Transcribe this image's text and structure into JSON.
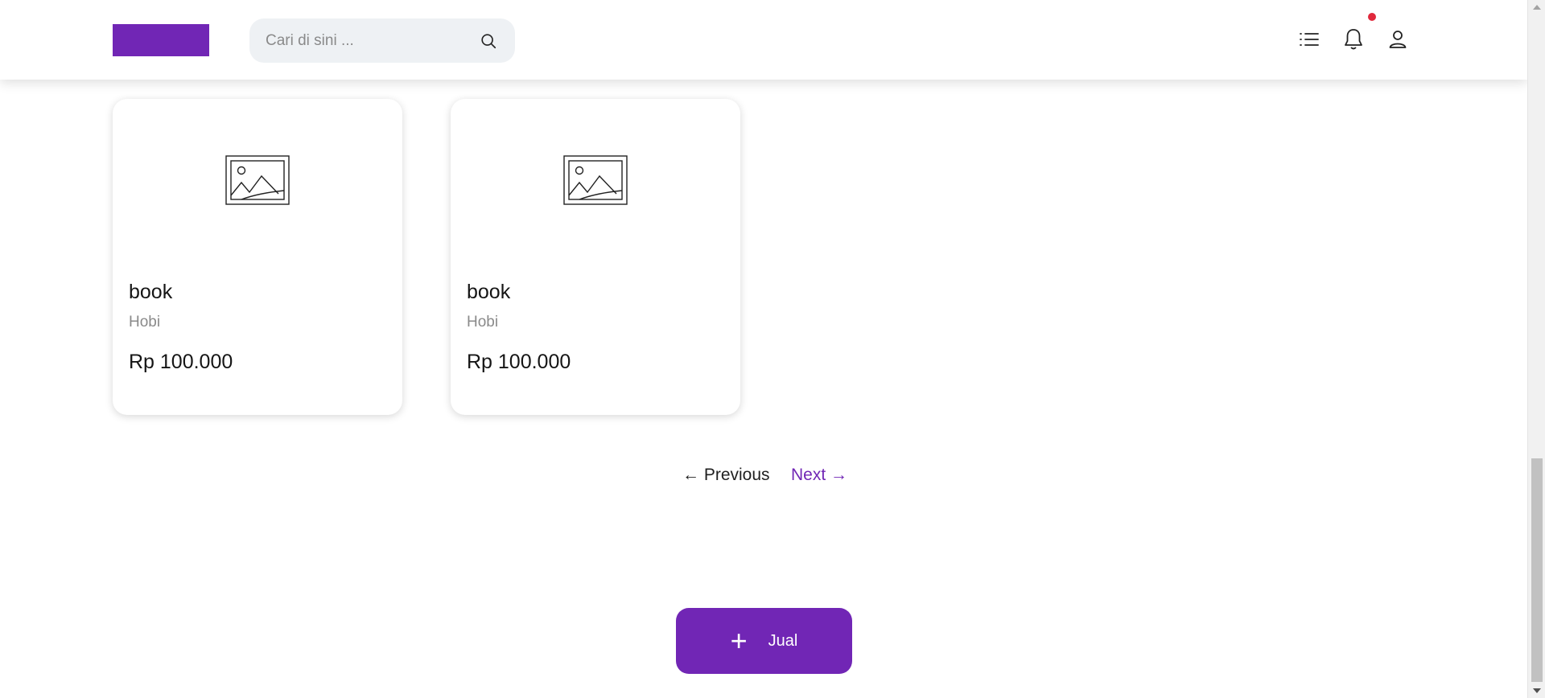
{
  "header": {
    "search": {
      "placeholder": "Cari di sini ...",
      "value": ""
    },
    "icons": [
      "list-icon",
      "bell-icon",
      "user-icon"
    ],
    "notification_dot": true
  },
  "products": [
    {
      "name": "book",
      "category": "Hobi",
      "price": "Rp 100.000"
    },
    {
      "name": "book",
      "category": "Hobi",
      "price": "Rp 100.000"
    }
  ],
  "pagination": {
    "previous_label": "← Previous",
    "next_label": "Next →"
  },
  "sell_button": {
    "icon": "+",
    "label": "Jual"
  },
  "colors": {
    "accent": "#7126b5",
    "notification": "#e0283c"
  }
}
